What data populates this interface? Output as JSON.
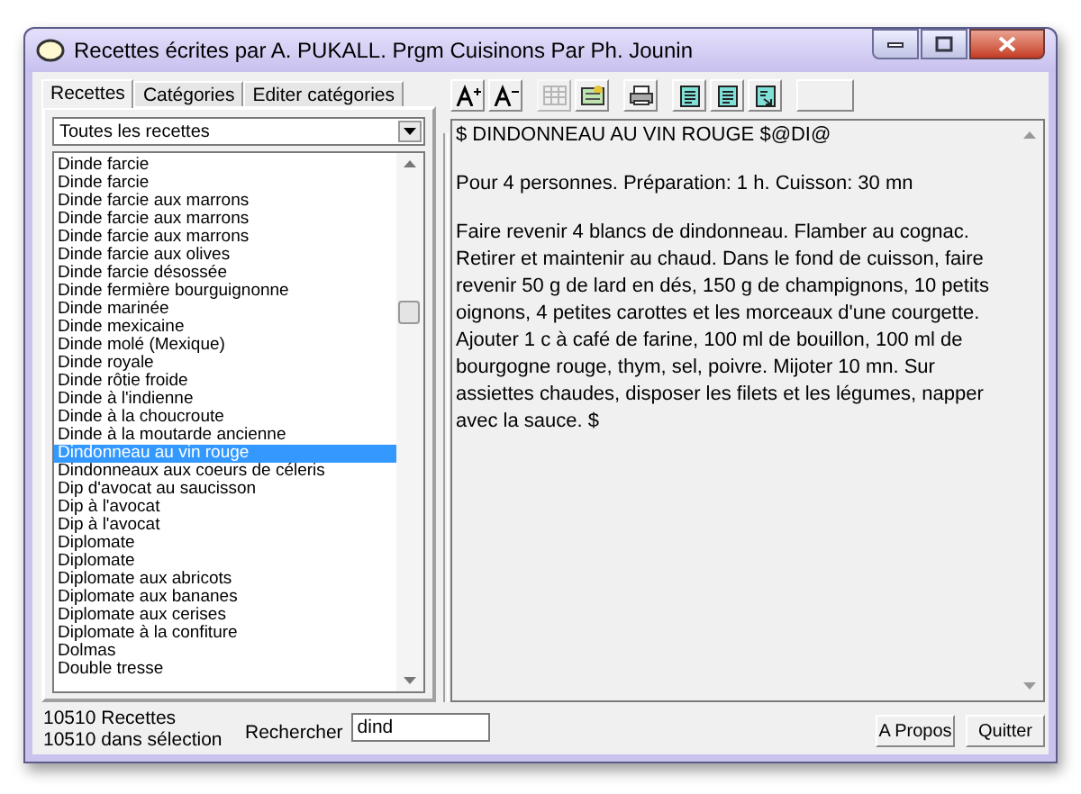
{
  "window": {
    "title": "Recettes écrites par A. PUKALL. Prgm Cuisinons Par Ph. Jounin"
  },
  "tabs": [
    {
      "label": "Recettes",
      "selected": true
    },
    {
      "label": "Catégories",
      "selected": false
    },
    {
      "label": "Editer catégories",
      "selected": false
    }
  ],
  "filter": {
    "value": "Toutes les recettes"
  },
  "recipes": [
    {
      "label": "Dinde farcie",
      "selected": false
    },
    {
      "label": "Dinde farcie",
      "selected": false
    },
    {
      "label": "Dinde farcie aux marrons",
      "selected": false
    },
    {
      "label": "Dinde farcie aux marrons",
      "selected": false
    },
    {
      "label": "Dinde farcie aux marrons",
      "selected": false
    },
    {
      "label": "Dinde farcie aux olives",
      "selected": false
    },
    {
      "label": "Dinde farcie désossée",
      "selected": false
    },
    {
      "label": "Dinde fermière bourguignonne",
      "selected": false
    },
    {
      "label": "Dinde marinée",
      "selected": false
    },
    {
      "label": "Dinde mexicaine",
      "selected": false
    },
    {
      "label": "Dinde molé (Mexique)",
      "selected": false
    },
    {
      "label": "Dinde royale",
      "selected": false
    },
    {
      "label": "Dinde rôtie froide",
      "selected": false
    },
    {
      "label": "Dinde à l'indienne",
      "selected": false
    },
    {
      "label": "Dinde à la choucroute",
      "selected": false
    },
    {
      "label": "Dinde à la moutarde ancienne",
      "selected": false
    },
    {
      "label": "Dindonneau au vin rouge",
      "selected": true
    },
    {
      "label": "Dindonneaux aux coeurs de céleris",
      "selected": false
    },
    {
      "label": "Dip d'avocat au saucisson",
      "selected": false
    },
    {
      "label": "Dip à l'avocat",
      "selected": false
    },
    {
      "label": "Dip à l'avocat",
      "selected": false
    },
    {
      "label": "Diplomate",
      "selected": false
    },
    {
      "label": "Diplomate",
      "selected": false
    },
    {
      "label": "Diplomate aux abricots",
      "selected": false
    },
    {
      "label": "Diplomate aux bananes",
      "selected": false
    },
    {
      "label": "Diplomate aux cerises",
      "selected": false
    },
    {
      "label": "Diplomate à la confiture",
      "selected": false
    },
    {
      "label": "Dolmas",
      "selected": false
    },
    {
      "label": "Double tresse",
      "selected": false
    }
  ],
  "toolbar": [
    {
      "kind": "font-larger",
      "disabled": false
    },
    {
      "kind": "font-smaller",
      "disabled": false
    },
    {
      "kind": "grid",
      "disabled": true
    },
    {
      "kind": "map",
      "disabled": false
    },
    {
      "kind": "print",
      "disabled": false
    },
    {
      "kind": "doc",
      "disabled": false
    },
    {
      "kind": "doc",
      "disabled": false
    },
    {
      "kind": "doc-export",
      "disabled": false
    },
    {
      "kind": "blank",
      "disabled": false
    }
  ],
  "recipe_text": [
    "$ DINDONNEAU AU VIN ROUGE $@DI@",
    "Pour 4 personnes. Préparation: 1 h. Cuisson: 30 mn",
    "Faire revenir 4 blancs de dindonneau. Flamber au cognac. Retirer et maintenir au chaud. Dans le fond de cuisson, faire revenir 50 g de lard en dés, 150 g de champignons, 10 petits oignons, 4 petites carottes et les morceaux d'une courgette. Ajouter 1 c à café de farine, 100 ml de bouillon, 100 ml de bourgogne rouge, thym, sel, poivre. Mijoter 10 mn. Sur assiettes chaudes, disposer les filets et les légumes, napper avec la sauce. $"
  ],
  "status": {
    "count": "10510 Recettes",
    "selection": "10510 dans sélection"
  },
  "search": {
    "label": "Rechercher",
    "value": "dind"
  },
  "buttons": [
    "A Propos",
    "Quitter"
  ]
}
